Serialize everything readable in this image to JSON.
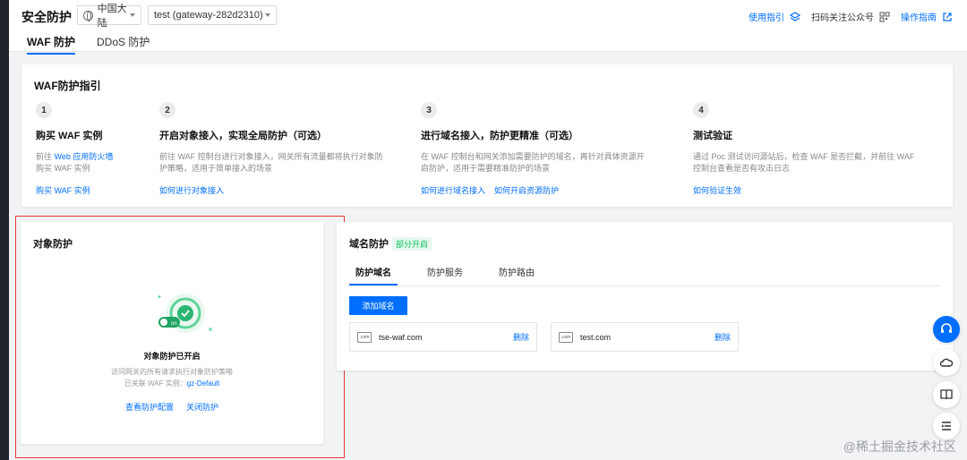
{
  "header": {
    "title": "安全防护",
    "region_select": "中国大陆",
    "instance_select": "test (gateway-282d2310)",
    "tabs": [
      "WAF 防护",
      "DDoS 防护"
    ],
    "links": {
      "guide": "使用指引",
      "follow": "扫码关注公众号",
      "manual": "操作指南"
    }
  },
  "guide_card": {
    "title": "WAF防护指引",
    "steps": [
      {
        "num": "1",
        "title": "购买 WAF 实例",
        "desc_prefix": "前往 ",
        "desc_link": "Web 应用防火墙",
        "desc_suffix": "购买 WAF 实例",
        "links": [
          "购买 WAF 实例"
        ]
      },
      {
        "num": "2",
        "title": "开启对象接入，实现全局防护（可选）",
        "desc": "前往 WAF 控制台进行对象接入，网关所有流量都将执行对象防护策略，适用于简单接入的场景",
        "links": [
          "如何进行对象接入"
        ]
      },
      {
        "num": "3",
        "title": "进行域名接入，防护更精准（可选）",
        "desc": "在 WAF 控制台和网关添加需要防护的域名，再针对具体资源开启防护，适用于需要精准防护的场景",
        "links": [
          "如何进行域名接入",
          "如何开启资源防护"
        ]
      },
      {
        "num": "4",
        "title": "测试验证",
        "desc": "通过 Poc 测试访问源站后，检查 WAF 是否拦截，并前往 WAF 控制台查看是否有攻击日志",
        "links": [
          "如何验证生效"
        ]
      }
    ]
  },
  "object_card": {
    "title": "对象防护",
    "badge_on": "on",
    "state": "对象防护已开启",
    "sub1": "访问网关的所有请求执行对象防护策略",
    "sub2_prefix": "已关联 WAF 实例：",
    "sub2_link": "gz-Default",
    "actions": [
      "查看防护配置",
      "关闭防护"
    ]
  },
  "domain_card": {
    "title": "域名防护",
    "badge": "部分开启",
    "tabs": [
      "防护域名",
      "防护服务",
      "防护路由"
    ],
    "add_button": "添加域名",
    "items": [
      {
        "icon": ".com",
        "name": "tse-waf.com",
        "action": "删除"
      },
      {
        "icon": ".com",
        "name": "test.com",
        "action": "删除"
      }
    ]
  },
  "float_buttons": [
    "headset-icon",
    "cloud-icon",
    "book-icon",
    "list-icon"
  ],
  "watermark": "@稀土掘金技术社区",
  "colors": {
    "primary": "#006eff",
    "success": "#0abf5b",
    "highlight_border": "#e53935"
  }
}
